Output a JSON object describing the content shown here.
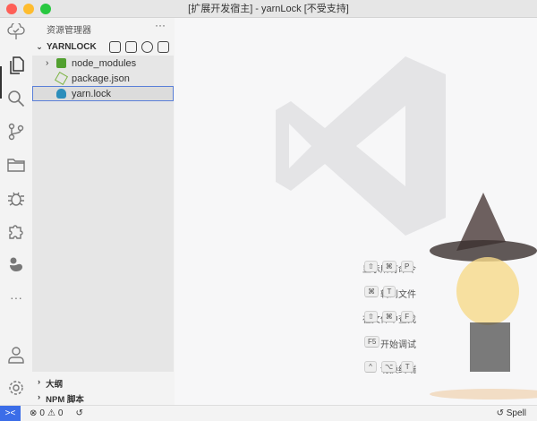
{
  "window": {
    "title": "[扩展开发宿主] - yarnLock [不受支持]"
  },
  "sidebar": {
    "title": "资源管理器",
    "more": "···",
    "section": "YARNLOCK",
    "items": [
      {
        "label": "node_modules",
        "type": "folder"
      },
      {
        "label": "package.json",
        "type": "node"
      },
      {
        "label": "yarn.lock",
        "type": "yarn"
      }
    ],
    "outline": [
      {
        "label": "大纲"
      },
      {
        "label": "NPM 脚本"
      }
    ]
  },
  "editor": {
    "shortcuts": [
      {
        "label": "显示所有命令",
        "keys": [
          "⇧",
          "⌘",
          "P"
        ]
      },
      {
        "label": "转到文件",
        "keys": [
          "⌘",
          "T"
        ]
      },
      {
        "label": "在文件中查找",
        "keys": [
          "⇧",
          "⌘",
          "F"
        ]
      },
      {
        "label": "开始调试",
        "keys": [
          "F5"
        ]
      },
      {
        "label": "切换终端",
        "keys": [
          "^",
          "⌥",
          "T"
        ]
      }
    ]
  },
  "status": {
    "remote": "><",
    "errors": "0",
    "warnings": "0",
    "spell": "Spell"
  },
  "colors": {
    "accent": "#3b6de8",
    "selection_border": "#5a7fd8"
  }
}
